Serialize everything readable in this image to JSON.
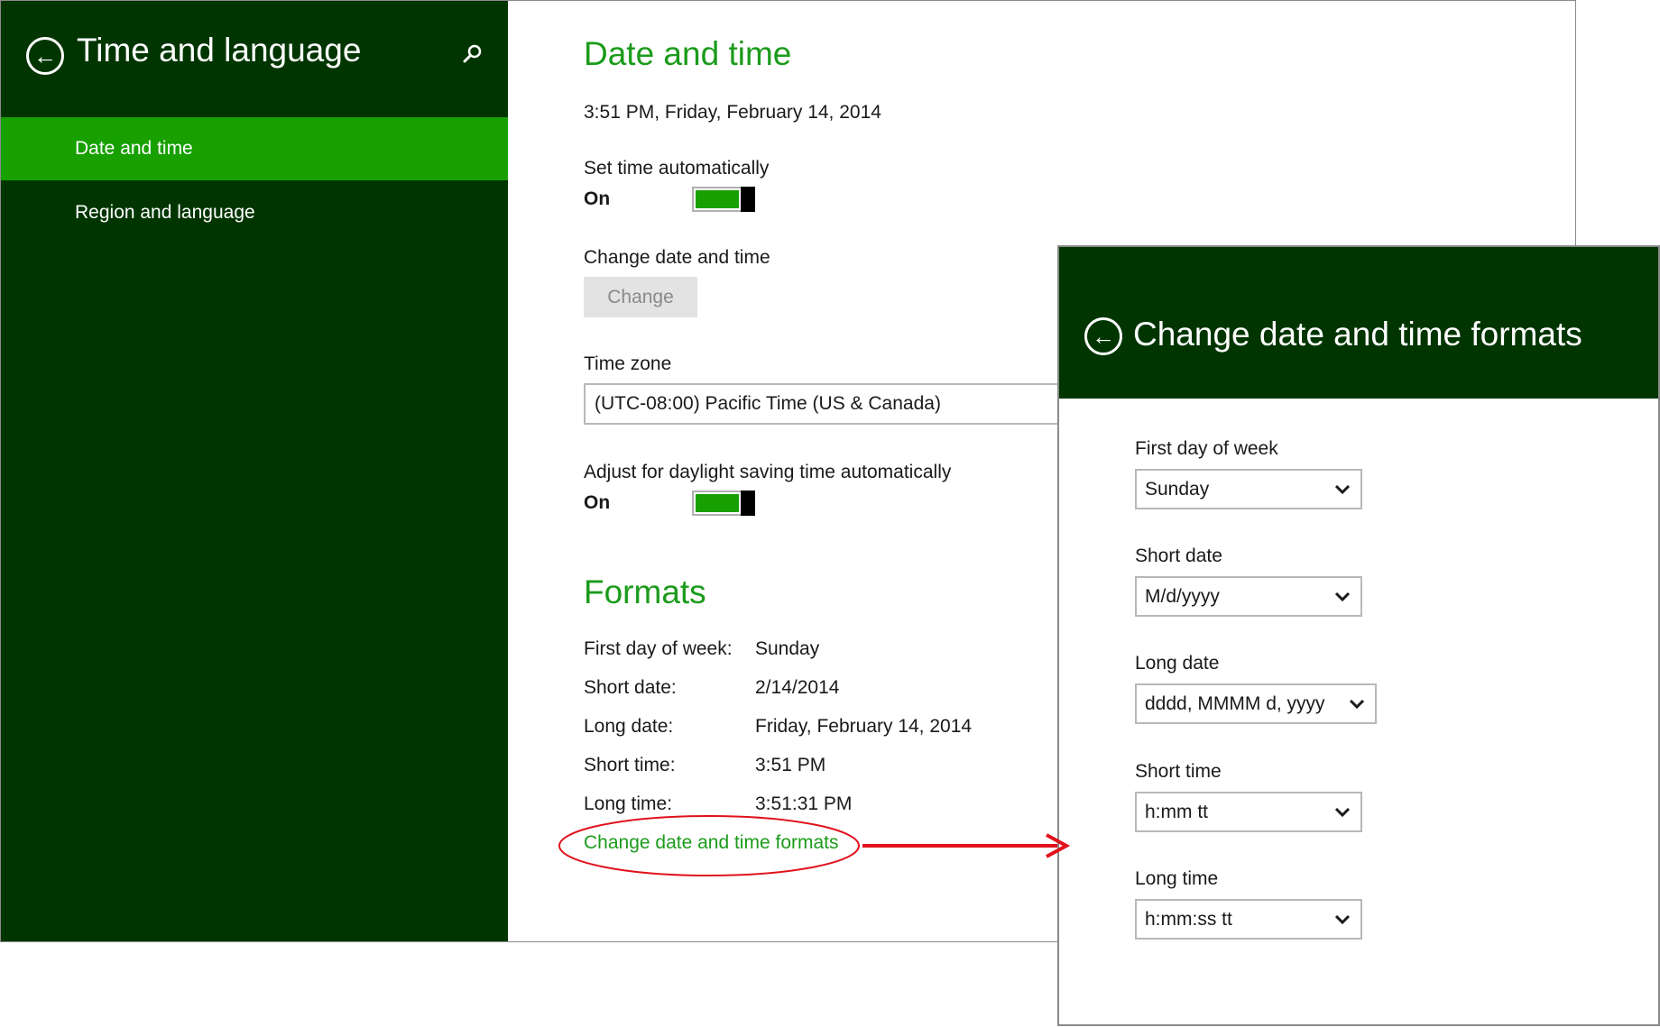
{
  "sidebar": {
    "title": "Time and language",
    "items": [
      {
        "label": "Date and time",
        "selected": true
      },
      {
        "label": "Region and language",
        "selected": false
      }
    ]
  },
  "main": {
    "heading": "Date and time",
    "current_datetime": "3:51 PM, Friday, February 14, 2014",
    "set_time_auto": {
      "label": "Set time automatically",
      "state": "On"
    },
    "change_datetime": {
      "label": "Change date and time",
      "button": "Change"
    },
    "time_zone": {
      "label": "Time zone",
      "value": "(UTC-08:00) Pacific Time (US & Canada)"
    },
    "dst": {
      "label": "Adjust for daylight saving time automatically",
      "state": "On"
    },
    "formats": {
      "heading": "Formats",
      "rows": [
        {
          "key": "First day of week:",
          "value": "Sunday"
        },
        {
          "key": "Short date:",
          "value": "2/14/2014"
        },
        {
          "key": "Long date:",
          "value": "Friday, February 14, 2014"
        },
        {
          "key": "Short time:",
          "value": "3:51 PM"
        },
        {
          "key": "Long time:",
          "value": "3:51:31 PM"
        }
      ],
      "link": "Change date and time formats"
    }
  },
  "panel": {
    "title": "Change date and time formats",
    "fields": [
      {
        "label": "First day of week",
        "value": "Sunday"
      },
      {
        "label": "Short date",
        "value": "M/d/yyyy"
      },
      {
        "label": "Long date",
        "value": "dddd, MMMM d, yyyy"
      },
      {
        "label": "Short time",
        "value": "h:mm tt"
      },
      {
        "label": "Long time",
        "value": "h:mm:ss tt"
      }
    ]
  },
  "colors": {
    "sidebar_bg": "#003500",
    "selected_bg": "#17a000",
    "accent_green": "#1b9b1b",
    "annotation_red": "#e0121c"
  },
  "icons": [
    "back-arrow-icon",
    "search-icon",
    "chevron-down-icon"
  ]
}
